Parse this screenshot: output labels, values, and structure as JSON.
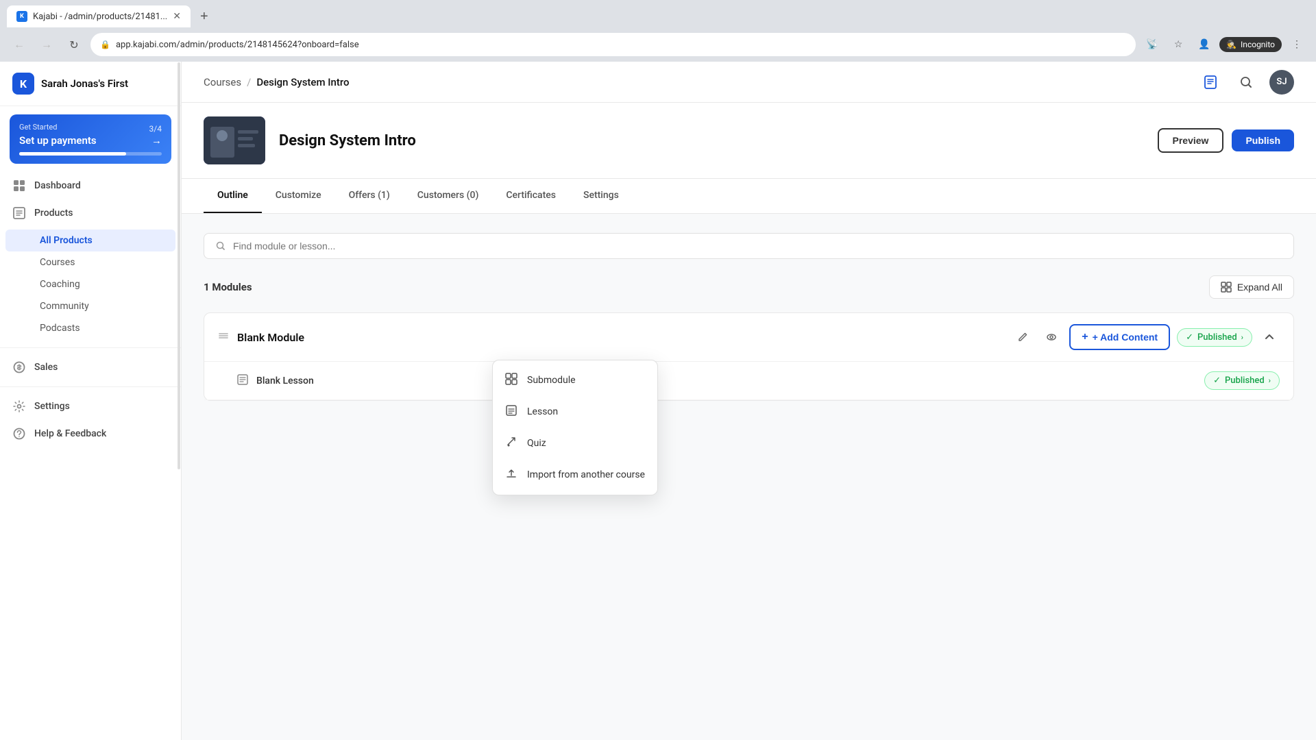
{
  "browser": {
    "tab_title": "Kajabi - /admin/products/21481...",
    "tab_favicon": "K",
    "address": "app.kajabi.com/admin/products/2148145624?onboard=false",
    "incognito_label": "Incognito"
  },
  "app": {
    "brand": "Sarah Jonas's First",
    "logo": "K"
  },
  "get_started": {
    "label": "Get Started",
    "progress_text": "3/4",
    "title": "Set up payments",
    "arrow": "→"
  },
  "nav": {
    "dashboard_label": "Dashboard",
    "products_label": "Products",
    "sales_label": "Sales",
    "settings_label": "Settings",
    "help_label": "Help & Feedback"
  },
  "sidebar_subitems": {
    "all_products": "All Products",
    "courses": "Courses",
    "coaching": "Coaching",
    "community": "Community",
    "podcasts": "Podcasts"
  },
  "header": {
    "breadcrumb_courses": "Courses",
    "breadcrumb_sep": "/",
    "breadcrumb_current": "Design System Intro",
    "avatar_initials": "SJ"
  },
  "course_tabs": {
    "outline": "Outline",
    "customize": "Customize",
    "offers": "Offers (1)",
    "customers": "Customers (0)",
    "certificates": "Certificates",
    "settings": "Settings"
  },
  "outline": {
    "search_placeholder": "Find module or lesson...",
    "modules_count_prefix": "1",
    "modules_count_suffix": " Modules",
    "expand_all_label": "Expand All"
  },
  "module": {
    "drag_handle": "≡",
    "title": "Blank Module",
    "add_content_label": "+ Add Content",
    "published_label": "Published",
    "collapse_icon": "∧"
  },
  "lesson": {
    "icon": "☰",
    "title": "Blank Lesson",
    "published_label": "Published"
  },
  "dropdown": {
    "submodule_label": "Submodule",
    "lesson_label": "Lesson",
    "quiz_label": "Quiz",
    "import_label": "Import from another course"
  },
  "icons": {
    "search": "🔍",
    "expand_all": "☰",
    "edit": "✏",
    "preview": "👁",
    "check": "✓",
    "chevron_down": "›",
    "collapse": "∧",
    "submodule": "⊞",
    "lesson": "☰",
    "quiz": "✏",
    "import": "⬆",
    "back": "←",
    "forward": "→",
    "reload": "↻",
    "home": "⌂",
    "book": "📖",
    "search_header": "🔍",
    "dashboard": "⊞",
    "product": "📦",
    "sales": "💰",
    "settings": "⚙",
    "help": "❓",
    "incognito": "🕵"
  },
  "colors": {
    "accent": "#1a56db",
    "published_green": "#16a34a",
    "published_bg": "#f0fdf4",
    "published_border": "#86efac"
  }
}
